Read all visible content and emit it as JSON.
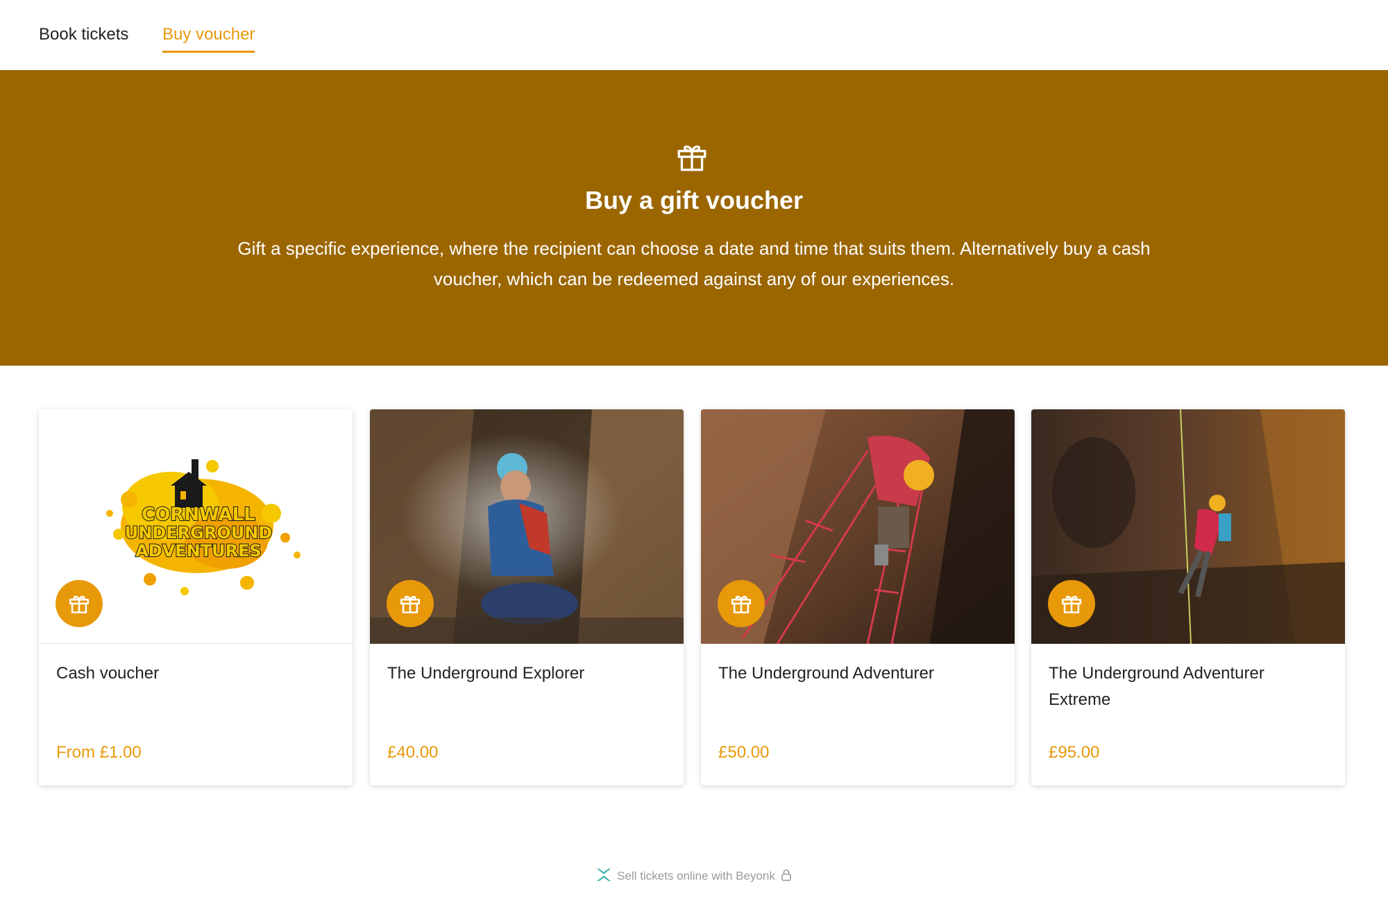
{
  "nav": {
    "tabs": [
      {
        "label": "Book tickets",
        "active": false
      },
      {
        "label": "Buy voucher",
        "active": true
      }
    ]
  },
  "hero": {
    "icon": "gift-icon",
    "title": "Buy a gift voucher",
    "description": "Gift a specific experience, where the recipient can choose a date and time that suits them. Alternatively buy a cash voucher, which can be redeemed against any of our experiences."
  },
  "cards": [
    {
      "title": "Cash voucher",
      "price": "From £1.00",
      "image": "logo",
      "logo_text": [
        "CORNWALL",
        "UNDERGROUND",
        "ADVENTURES"
      ]
    },
    {
      "title": "The Underground Explorer",
      "price": "£40.00",
      "image": "cave-photo"
    },
    {
      "title": "The Underground Adventurer",
      "price": "£50.00",
      "image": "cave-photo"
    },
    {
      "title": "The Underground Adventurer Extreme",
      "price": "£95.00",
      "image": "cave-photo"
    }
  ],
  "footer": {
    "text": "Sell tickets online with Beyonk",
    "brand_icon": "beyonk-logo-icon",
    "lock_icon": "lock-icon"
  },
  "colors": {
    "accent": "#E8990A",
    "hero_background": "#9B6600",
    "brand_teal": "#3BB3B0"
  }
}
